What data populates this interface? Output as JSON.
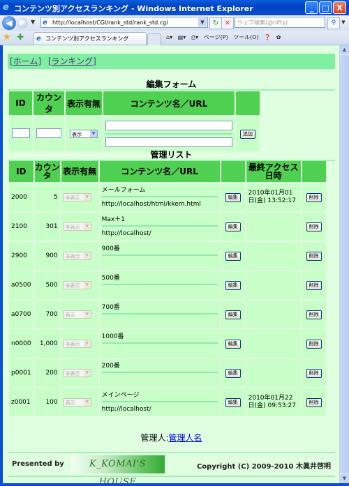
{
  "window": {
    "title": "コンテンツ別アクセスランキング - Windows Internet Explorer",
    "minimize": "_",
    "maximize": "□",
    "close": "X"
  },
  "browser": {
    "address": "http://localhost/CGI/rank_std/rank_std.cgi",
    "search_placeholder": "ウェブ検索(@nifty)",
    "tab_label": "コンテンツ別アクセスランキング",
    "commands": [
      "ページ(P)",
      "ツール(O)"
    ]
  },
  "nav": {
    "home": "[ホーム]",
    "ranking": "[ランキング]"
  },
  "edit_form": {
    "title": "編集フォーム",
    "headers": [
      "ID",
      "カウンタ",
      "表示有無",
      "コンテンツ名／URL",
      ""
    ],
    "id_value": "",
    "counter_value": "",
    "display_selected": "表示",
    "name_value": "",
    "url_value": "",
    "add_label": "追加"
  },
  "list": {
    "title": "管理リスト",
    "headers": [
      "ID",
      "カウンタ",
      "表示有無",
      "コンテンツ名／URL",
      "",
      "最終アクセス日時",
      ""
    ],
    "edit_label": "編集",
    "delete_label": "削除",
    "rows": [
      {
        "id": "2000",
        "count": "5",
        "display": "非表示",
        "name": "メールフォーム",
        "url": "http://localhost/html/kkem.html",
        "datetime": "2010年01月01日(金) 13:52:17"
      },
      {
        "id": "2100",
        "count": "301",
        "display": "非表示",
        "name": "Max＋1",
        "url": "http://localhost/",
        "datetime": ""
      },
      {
        "id": "2900",
        "count": "900",
        "display": "非表示",
        "name": "900番",
        "url": "",
        "datetime": ""
      },
      {
        "id": "a0500",
        "count": "500",
        "display": "非表示",
        "name": "500番",
        "url": "",
        "datetime": ""
      },
      {
        "id": "a0700",
        "count": "700",
        "display": "表示",
        "name": "700番",
        "url": "",
        "datetime": ""
      },
      {
        "id": "n0000",
        "count": "1,000",
        "display": "非表示",
        "name": "1000番",
        "url": "",
        "datetime": ""
      },
      {
        "id": "p0001",
        "count": "200",
        "display": "非表示",
        "name": "200番",
        "url": "",
        "datetime": ""
      },
      {
        "id": "z0001",
        "count": "100",
        "display": "表示",
        "name": "メインページ",
        "url": "http://localhost/",
        "datetime": "2010年01月22日(金) 09:53:27"
      }
    ]
  },
  "admin": {
    "label": "管理人:",
    "name": "管理人名"
  },
  "footer": {
    "presented_by": "Presented by",
    "logo_text": "K_KOMAI'S HOUSE",
    "copyright": "Copyright (C) 2009-2010 木眞井啓明"
  }
}
